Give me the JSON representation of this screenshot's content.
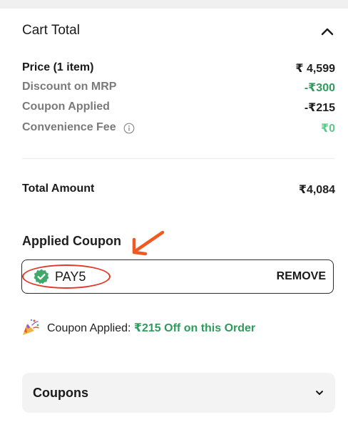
{
  "cart_total": {
    "title": "Cart Total",
    "rows": [
      {
        "label": "Price (1 item)",
        "value": "₹ 4,599"
      },
      {
        "label": "Discount on MRP",
        "value": "-₹300"
      },
      {
        "label": "Coupon Applied",
        "value": "-₹215"
      },
      {
        "label": "Convenience Fee",
        "value": "₹0"
      }
    ],
    "total": {
      "label": "Total Amount",
      "value": "₹4,084"
    }
  },
  "applied_coupon": {
    "title": "Applied Coupon",
    "code": "PAY5",
    "remove_label": "REMOVE"
  },
  "applied_message": {
    "prefix": "Coupon Applied: ",
    "highlight": "₹215 Off on this Order"
  },
  "coupons_panel": {
    "title": "Coupons"
  },
  "colors": {
    "discount_green": "#2e9c5a",
    "fee_green": "#5bc98a",
    "annotation_red": "#e0382b",
    "annotation_arrow": "#f05a22"
  },
  "icons": [
    "chevron-up-icon",
    "info-icon",
    "verified-badge-icon",
    "party-popper-icon",
    "chevron-down-icon",
    "arrow-annotation"
  ]
}
